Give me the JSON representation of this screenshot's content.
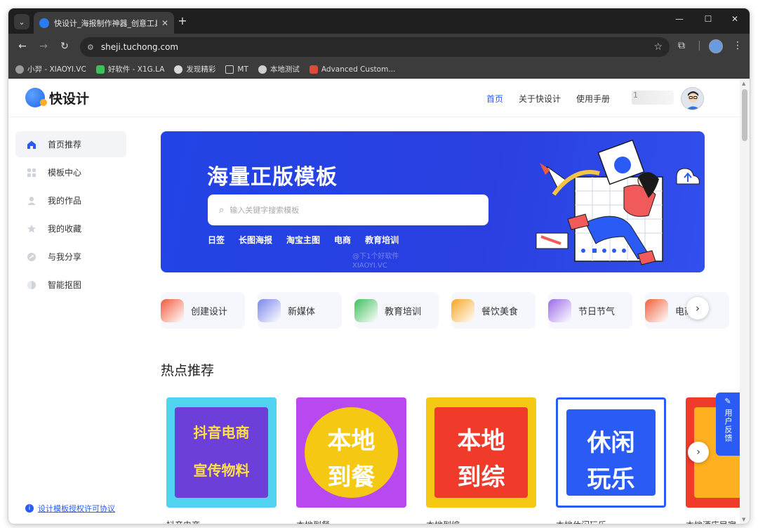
{
  "browser": {
    "tab_title": "快设计_海报制作神器_创意工具",
    "url": "sheji.tuchong.com",
    "bookmarks": [
      {
        "label": "小羿 - XIAOYI.VC",
        "icon": "xiaoyi-icon",
        "color": "#9a9a9a"
      },
      {
        "label": "好软件 - X1G.LA",
        "icon": "x1g-icon",
        "color": "#3fbf5a"
      },
      {
        "label": "发现精彩",
        "icon": "wordpress-icon",
        "color": "#d8d8d8"
      },
      {
        "label": "MT",
        "icon": "folder-icon",
        "color": "#cfcfcf"
      },
      {
        "label": "本地测试",
        "icon": "globe-icon",
        "color": "#cfcfcf"
      },
      {
        "label": "Advanced Custom...",
        "icon": "acf-icon",
        "color": "#e04a3a"
      }
    ]
  },
  "header": {
    "logo_text": "快设计",
    "nav": [
      "首页",
      "关于快设计",
      "使用手册"
    ],
    "active_nav": "首页",
    "user_name": "1"
  },
  "sidebar": {
    "items": [
      {
        "label": "首页推荐",
        "icon": "home-icon",
        "active": true
      },
      {
        "label": "模板中心",
        "icon": "grid-icon",
        "active": false
      },
      {
        "label": "我的作品",
        "icon": "user-icon",
        "active": false
      },
      {
        "label": "我的收藏",
        "icon": "star-icon",
        "active": false
      },
      {
        "label": "与我分享",
        "icon": "share-icon",
        "active": false
      },
      {
        "label": "智能抠图",
        "icon": "toggle-icon",
        "active": false
      }
    ],
    "license_link": "设计模板授权许可协议"
  },
  "banner": {
    "title": "海量正版模板",
    "search_placeholder": "输入关键字搜索模板",
    "hot_links": [
      "日签",
      "长图海报",
      "淘宝主图",
      "电商",
      "教育培训"
    ],
    "watermark": "@下1个好软件\nXIAOYI.VC"
  },
  "categories": [
    {
      "label": "创建设计",
      "color": "#f05a3c"
    },
    {
      "label": "新媒体",
      "color": "#7a86e8"
    },
    {
      "label": "教育培训",
      "color": "#3fbf5a"
    },
    {
      "label": "餐饮美食",
      "color": "#f5a623"
    },
    {
      "label": "节日节气",
      "color": "#9b6ae8"
    },
    {
      "label": "电商",
      "color": "#f0603c"
    }
  ],
  "hot": {
    "title": "热点推荐",
    "cards": [
      {
        "name": "抖音电商",
        "line1": "抖音电商",
        "line2": "宣传物料"
      },
      {
        "name": "本地到餐",
        "line1": "本地",
        "line2": "到餐"
      },
      {
        "name": "本地到综",
        "line1": "本地",
        "line2": "到综"
      },
      {
        "name": "本地休闲玩乐",
        "line1": "休闲",
        "line2": "玩乐"
      },
      {
        "name": "本地酒店民宿",
        "line1": "",
        "line2": ""
      }
    ]
  },
  "feedback_label": "用户反馈"
}
